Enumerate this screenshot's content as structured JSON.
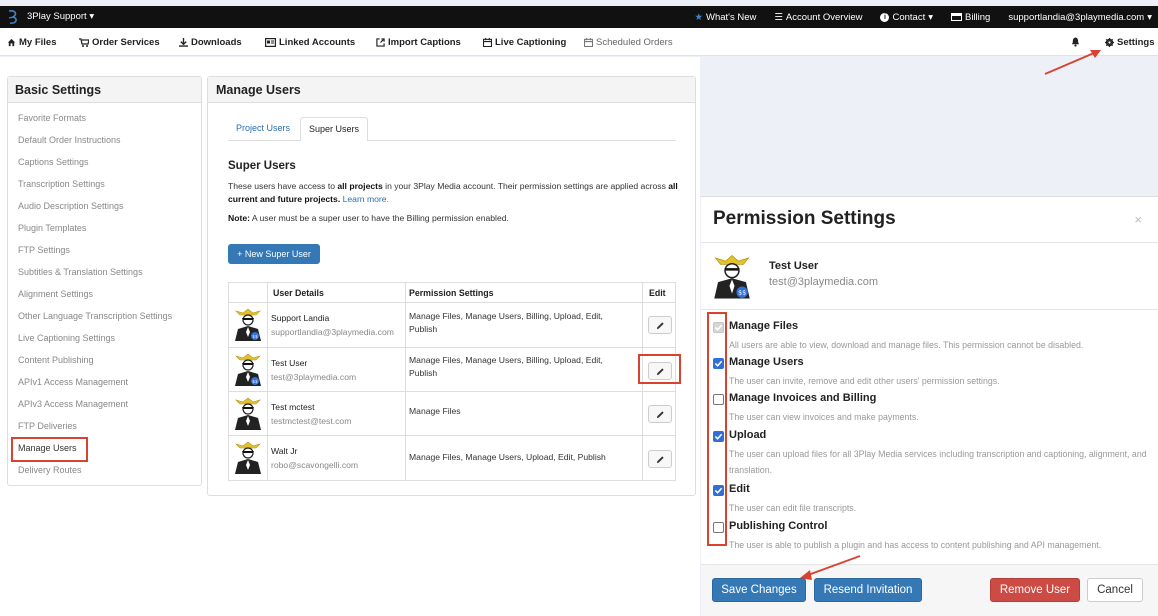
{
  "topbar": {
    "brand": "3Play Support",
    "items": [
      {
        "label": "What's New",
        "icon": "star-icon"
      },
      {
        "label": "Account Overview",
        "icon": "list-icon"
      },
      {
        "label": "Contact",
        "icon": "info-icon"
      },
      {
        "label": "Billing",
        "icon": "card-icon"
      },
      {
        "label": "supportlandia@3playmedia.com",
        "icon": "caret-down-icon"
      }
    ]
  },
  "navbar": {
    "items": [
      {
        "label": "My Files",
        "icon": "home-icon"
      },
      {
        "label": "Order Services",
        "icon": "cart-icon"
      },
      {
        "label": "Downloads",
        "icon": "download-icon"
      },
      {
        "label": "Linked Accounts",
        "icon": "id-card-icon"
      },
      {
        "label": "Import Captions",
        "icon": "import-icon"
      },
      {
        "label": "Live Captioning",
        "icon": "calendar-icon"
      },
      {
        "label": "Scheduled Orders",
        "icon": "calendar-icon"
      }
    ],
    "settings_label": "Settings"
  },
  "sidebar": {
    "title": "Basic Settings",
    "items": [
      "Favorite Formats",
      "Default Order Instructions",
      "Captions Settings",
      "Transcription Settings",
      "Audio Description Settings",
      "Plugin Templates",
      "FTP Settings",
      "Subtitles & Translation Settings",
      "Alignment Settings",
      "Other Language Transcription Settings",
      "Live Captioning Settings",
      "Content Publishing",
      "APIv1 Access Management",
      "APIv3 Access Management",
      "FTP Deliveries",
      "Manage Users",
      "Delivery Routes"
    ],
    "active_index": 15
  },
  "manage_users": {
    "title": "Manage Users",
    "tabs": [
      "Project Users",
      "Super Users"
    ],
    "section_title": "Super Users",
    "intro_1": "These users have access to ",
    "intro_b1": "all projects",
    "intro_2": " in your 3Play Media account. Their permission settings are applied across ",
    "intro_b2": "all current and future projects.",
    "intro_link": "Learn more.",
    "note_b": "Note:",
    "note_text": " A user must be a super user to have the Billing permission enabled.",
    "new_button": "+ New Super User",
    "columns": [
      "User Details",
      "Permission Settings",
      "Edit"
    ],
    "rows": [
      {
        "name": "Support Landia",
        "email": "supportlandia@3playmedia.com",
        "permissions": "Manage Files, Manage Users, Billing, Upload, Edit, Publish"
      },
      {
        "name": "Test User",
        "email": "test@3playmedia.com",
        "permissions": "Manage Files, Manage Users, Billing, Upload, Edit, Publish"
      },
      {
        "name": "Test mctest",
        "email": "testmctest@test.com",
        "permissions": "Manage Files"
      },
      {
        "name": "Walt Jr",
        "email": "robo@scavongelli.com",
        "permissions": "Manage Files, Manage Users, Upload, Edit, Publish"
      }
    ]
  },
  "modal": {
    "title": "Permission Settings",
    "close": "×",
    "user_name": "Test User",
    "user_email": "test@3playmedia.com",
    "permissions": [
      {
        "label": "Manage Files",
        "desc": "All users are able to view, download and manage files. This permission cannot be disabled.",
        "state": "disabled"
      },
      {
        "label": "Manage Users",
        "desc": "The user can invite, remove and edit other users' permission settings.",
        "state": "checked"
      },
      {
        "label": "Manage Invoices and Billing",
        "desc": "The user can view invoices and make payments.",
        "state": "unchecked"
      },
      {
        "label": "Upload",
        "desc": "The user can upload files for all 3Play Media services including transcription and captioning, alignment, and translation.",
        "state": "checked"
      },
      {
        "label": "Edit",
        "desc": "The user can edit file transcripts.",
        "state": "checked"
      },
      {
        "label": "Publishing Control",
        "desc": "The user is able to publish a plugin and has access to content publishing and API management.",
        "state": "unchecked"
      }
    ],
    "buttons": {
      "save": "Save Changes",
      "resend": "Resend Invitation",
      "remove": "Remove User",
      "cancel": "Cancel"
    }
  },
  "colors": {
    "accent": "#3478b6",
    "danger": "#cc4b44",
    "highlight": "#d9422e",
    "checkbox": "#2f6fd6"
  }
}
